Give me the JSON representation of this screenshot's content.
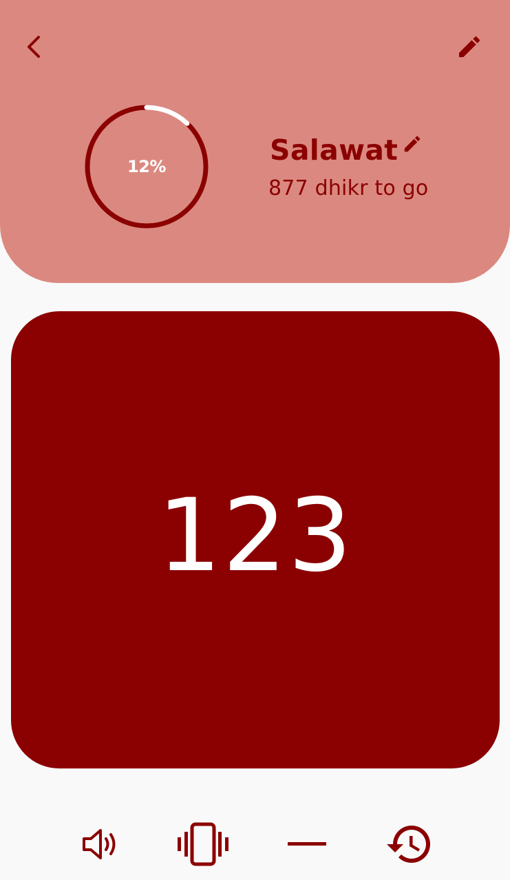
{
  "header": {
    "back_icon": "chevron-left-icon",
    "edit_icon": "pencil-icon",
    "background_color": "#db8980"
  },
  "progress": {
    "label": "12%",
    "value": 0.12,
    "track_color": "#8b0000",
    "fill_color": "#ffffff"
  },
  "dhikr": {
    "title": "Salawat",
    "remaining_text": "877 dhikr to go"
  },
  "counter": {
    "value": "123",
    "background_color": "#8b0000"
  },
  "toolbar": {
    "items": [
      {
        "icon": "volume-icon"
      },
      {
        "icon": "vibrate-icon"
      },
      {
        "icon": "minus-icon"
      },
      {
        "icon": "history-icon"
      }
    ]
  },
  "accent_color": "#8b0000"
}
